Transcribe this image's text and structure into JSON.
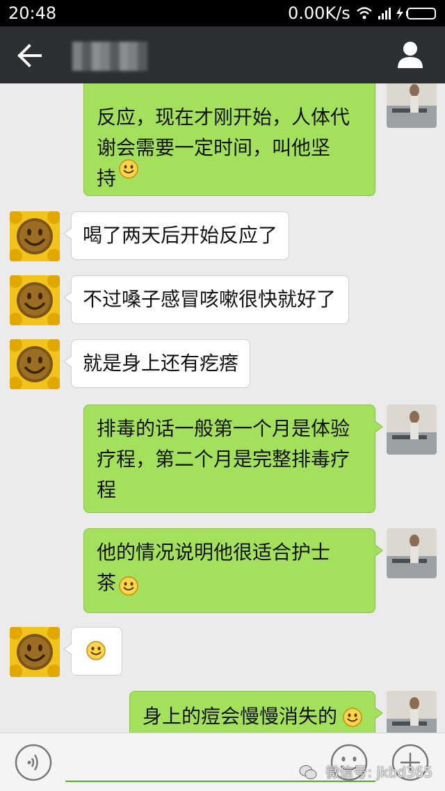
{
  "status_bar": {
    "time": "20:48",
    "network_speed": "0.00K/s"
  },
  "nav": {
    "back_icon": "arrow-left-icon",
    "profile_icon": "person-icon"
  },
  "messages": [
    {
      "side": "out",
      "lines": "反应，现在才刚开始，人体代\n谢会需要一定时间，叫他坚\n持",
      "emoji": true
    },
    {
      "side": "in",
      "lines": "喝了两天后开始反应了",
      "emoji": false
    },
    {
      "side": "in",
      "lines": "不过嗓子感冒咳嗽很快就好了",
      "emoji": false
    },
    {
      "side": "in",
      "lines": "就是身上还有疙瘩",
      "emoji": false
    },
    {
      "side": "out",
      "lines": "排毒的话一般第一个月是体验\n疗程，第二个月是完整排毒疗\n程",
      "emoji": false
    },
    {
      "side": "out",
      "lines": "他的情况说明他很适合护士\n茶",
      "emoji": true
    },
    {
      "side": "in",
      "lines": "",
      "emoji": true
    },
    {
      "side": "out",
      "lines": "身上的痘会慢慢消失的",
      "emoji": true
    }
  ],
  "input_bar": {
    "placeholder": "",
    "voice_icon": "voice-icon",
    "emoji_icon": "smiley-face-icon",
    "plus_icon": "plus-icon",
    "watermark": "微信号: jkbd365"
  },
  "colors": {
    "nav_bg": "#2c3035",
    "chat_bg": "#ebebeb",
    "outgoing_bubble": "#a3e05c",
    "incoming_bubble": "#ffffff",
    "input_underline": "#46b11a"
  }
}
